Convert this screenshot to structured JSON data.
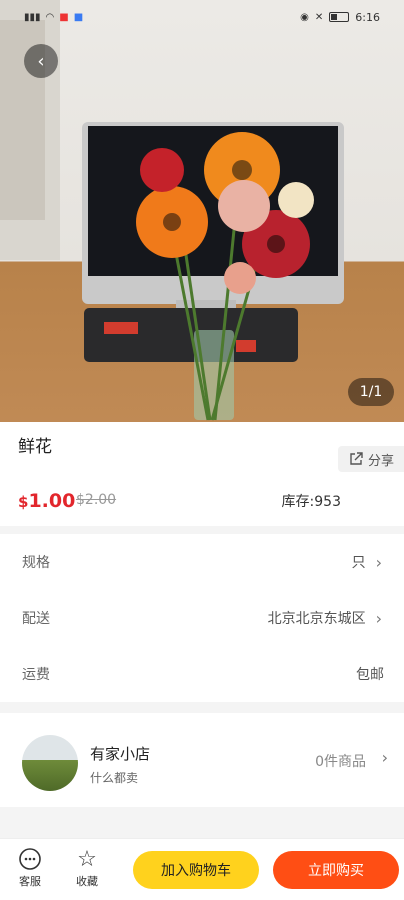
{
  "status_bar": {
    "time": "6:16"
  },
  "gallery": {
    "counter": "1/1"
  },
  "product": {
    "title": "鲜花",
    "share_label": "分享",
    "price_symbol": "$",
    "price": "1.00",
    "original_price": "$2.00",
    "stock": "库存:953"
  },
  "options": [
    {
      "label": "规格",
      "value": "只",
      "has_arrow": true
    },
    {
      "label": "配送",
      "value": "北京北京东城区",
      "has_arrow": true
    },
    {
      "label": "运费",
      "value": "包邮",
      "has_arrow": false
    }
  ],
  "store": {
    "name": "有家小店",
    "description": "什么都卖",
    "product_count": "0件商品"
  },
  "bottom_bar": {
    "service_label": "客服",
    "favorite_label": "收藏",
    "add_to_cart": "加入购物车",
    "buy_now": "立即购买"
  },
  "colors": {
    "price": "#e2262c",
    "cart_button": "#ffd21d",
    "buy_button": "#ff4e14"
  }
}
